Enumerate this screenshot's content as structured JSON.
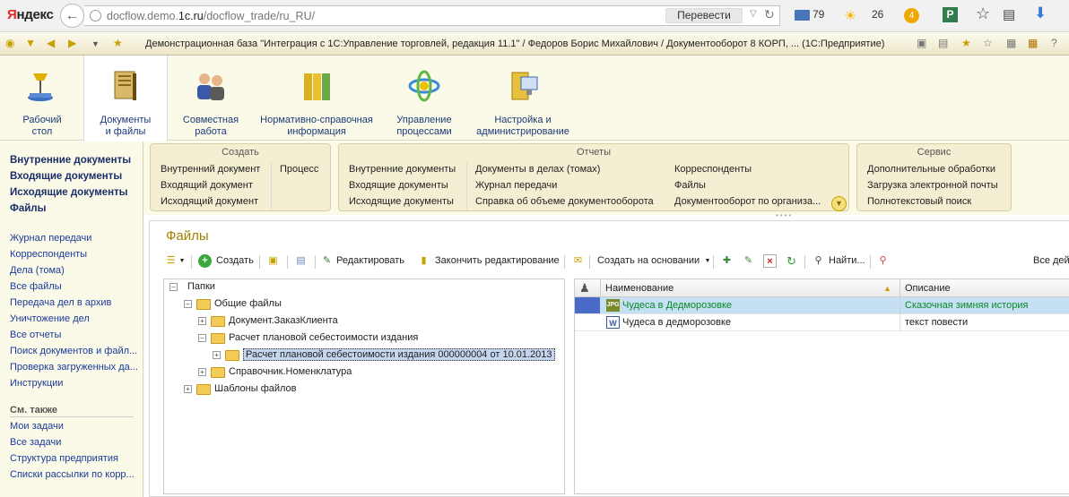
{
  "browser": {
    "logo": "Яндекс",
    "url_host": "docflow.demo.",
    "url_host_bold": "1c.ru",
    "url_path": "/docflow_trade/ru_RU/",
    "translate_label": "Перевести",
    "mail_count": "79",
    "weather_temp": "26",
    "coin_count": "4"
  },
  "app": {
    "title": "Демонстрационная база \"Интеграция с 1С:Управление торговлей, редакция 11.1\" / Федоров Борис Михайлович / Документооборот 8 КОРП, ... (1С:Предприятие)"
  },
  "sections": [
    {
      "label": "Рабочий\nстол",
      "icon": "desk-lamp-icon"
    },
    {
      "label": "Документы\nи файлы",
      "icon": "documents-icon"
    },
    {
      "label": "Совместная\nработа",
      "icon": "people-icon"
    },
    {
      "label": "Нормативно-справочная\nинформация",
      "icon": "binders-icon"
    },
    {
      "label": "Управление\nпроцессами",
      "icon": "process-icon"
    },
    {
      "label": "Настройка и\nадминистрирование",
      "icon": "server-icon"
    }
  ],
  "left_nav": {
    "main": [
      "Внутренние документы",
      "Входящие документы",
      "Исходящие документы",
      "Файлы"
    ],
    "links": [
      "Журнал передачи",
      "Корреспонденты",
      "Дела (тома)",
      "Все файлы",
      "Передача дел в архив",
      "Уничтожение дел",
      "Все отчеты",
      "Поиск документов и файл...",
      "Проверка загруженных да...",
      "Инструкции"
    ],
    "see_also_title": "См. также",
    "see_also": [
      "Мои задачи",
      "Все задачи",
      "Структура предприятия",
      "Списки рассылки по корр..."
    ]
  },
  "commands": {
    "create": {
      "title": "Создать",
      "col1": [
        "Внутренний документ",
        "Входящий документ",
        "Исходящий документ"
      ],
      "col2": [
        "Процесс"
      ]
    },
    "reports": {
      "title": "Отчеты",
      "col1": [
        "Внутренние документы",
        "Входящие документы",
        "Исходящие документы"
      ],
      "col2": [
        "Документы в делах (томах)",
        "Журнал передачи",
        "Справка об объеме документооборота"
      ],
      "col3": [
        "Корреспонденты",
        "Файлы",
        "Документооборот по организа..."
      ]
    },
    "service": {
      "title": "Сервис",
      "col1": [
        "Дополнительные обработки",
        "Загрузка электронной почты",
        "Полнотекстовый поиск"
      ]
    }
  },
  "files": {
    "title": "Файлы",
    "toolbar": {
      "create": "Создать",
      "edit": "Редактировать",
      "finish_edit": "Закончить редактирование",
      "create_based": "Создать на основании",
      "find": "Найти...",
      "all": "Все дей"
    },
    "tree": {
      "root": "Папки",
      "general": "Общие файлы",
      "order": "Документ.ЗаказКлиента",
      "calc": "Расчет плановой себестоимости издания",
      "calc_item": "Расчет плановой себестоимости издания  000000004 от 10.01.2013",
      "nomenclature": "Справочник.Номенклатура",
      "templates": "Шаблоны файлов"
    },
    "grid": {
      "col_name": "Наименование",
      "col_desc": "Описание",
      "rows": [
        {
          "name": "Чудеса в Дедморозовке",
          "desc": "Сказочная зимняя история",
          "icon": "jpeg-file-icon",
          "icon_label": "JPG"
        },
        {
          "name": "Чудеса в дедморозовке",
          "desc": "текст повести",
          "icon": "word-file-icon",
          "icon_label": "W"
        }
      ]
    }
  },
  "colors": {
    "accent_gold": "#a08200",
    "link_blue": "#1a3a9a",
    "selected_row": "#c5e0f2",
    "green_text": "#0a8a28"
  }
}
